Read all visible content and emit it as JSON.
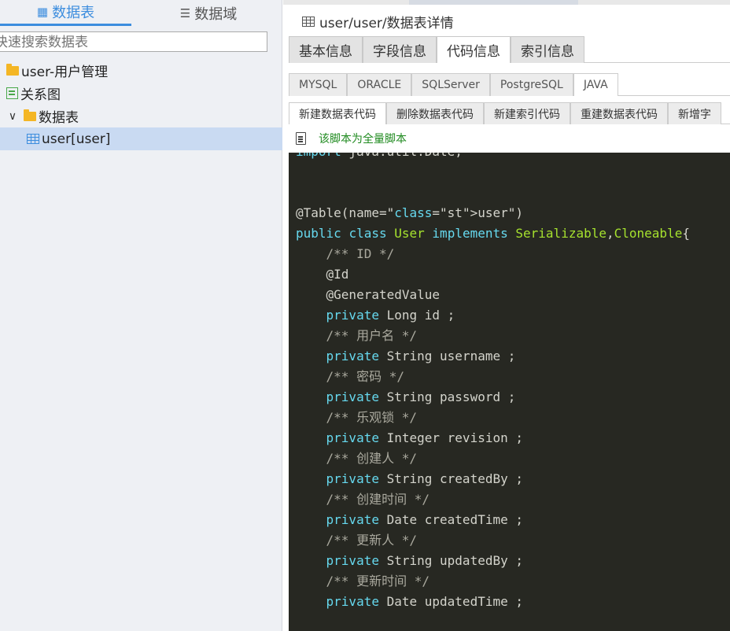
{
  "left_panel": {
    "tabs": [
      {
        "label": "数据表",
        "active": true,
        "icon": "grid-icon"
      },
      {
        "label": "数据域",
        "active": false,
        "icon": "list-icon"
      }
    ],
    "search": {
      "placeholder": "快速搜索数据表"
    },
    "tree": [
      {
        "label": "user-用户管理",
        "icon": "folder-icon"
      },
      {
        "label": "关系图",
        "icon": "diagram-icon"
      },
      {
        "label": "数据表",
        "icon": "folder-icon",
        "expanded": true
      },
      {
        "label": "user[user]",
        "icon": "table-icon",
        "selected": true
      }
    ]
  },
  "right_panel": {
    "title": "user/user/数据表详情",
    "main_tabs": [
      "基本信息",
      "字段信息",
      "代码信息",
      "索引信息"
    ],
    "main_tab_active": "代码信息",
    "lang_tabs": [
      "MYSQL",
      "ORACLE",
      "SQLServer",
      "PostgreSQL",
      "JAVA"
    ],
    "lang_tab_active": "JAVA",
    "action_tabs": [
      "新建数据表代码",
      "删除数据表代码",
      "新建索引代码",
      "重建数据表代码",
      "新增字"
    ],
    "action_tab_active": "新建数据表代码",
    "note": "该脚本为全量脚本",
    "code_lines": [
      "import java.util.Date;",
      "",
      "",
      "@Table(name=\"user\")",
      "public class User implements Serializable,Cloneable{",
      "    /** ID */",
      "    @Id",
      "    @GeneratedValue",
      "    private Long id ;",
      "    /** 用户名 */",
      "    private String username ;",
      "    /** 密码 */",
      "    private String password ;",
      "    /** 乐观锁 */",
      "    private Integer revision ;",
      "    /** 创建人 */",
      "    private String createdBy ;",
      "    /** 创建时间 */",
      "    private Date createdTime ;",
      "    /** 更新人 */",
      "    private String updatedBy ;",
      "    /** 更新时间 */",
      "    private Date updatedTime ;"
    ]
  }
}
